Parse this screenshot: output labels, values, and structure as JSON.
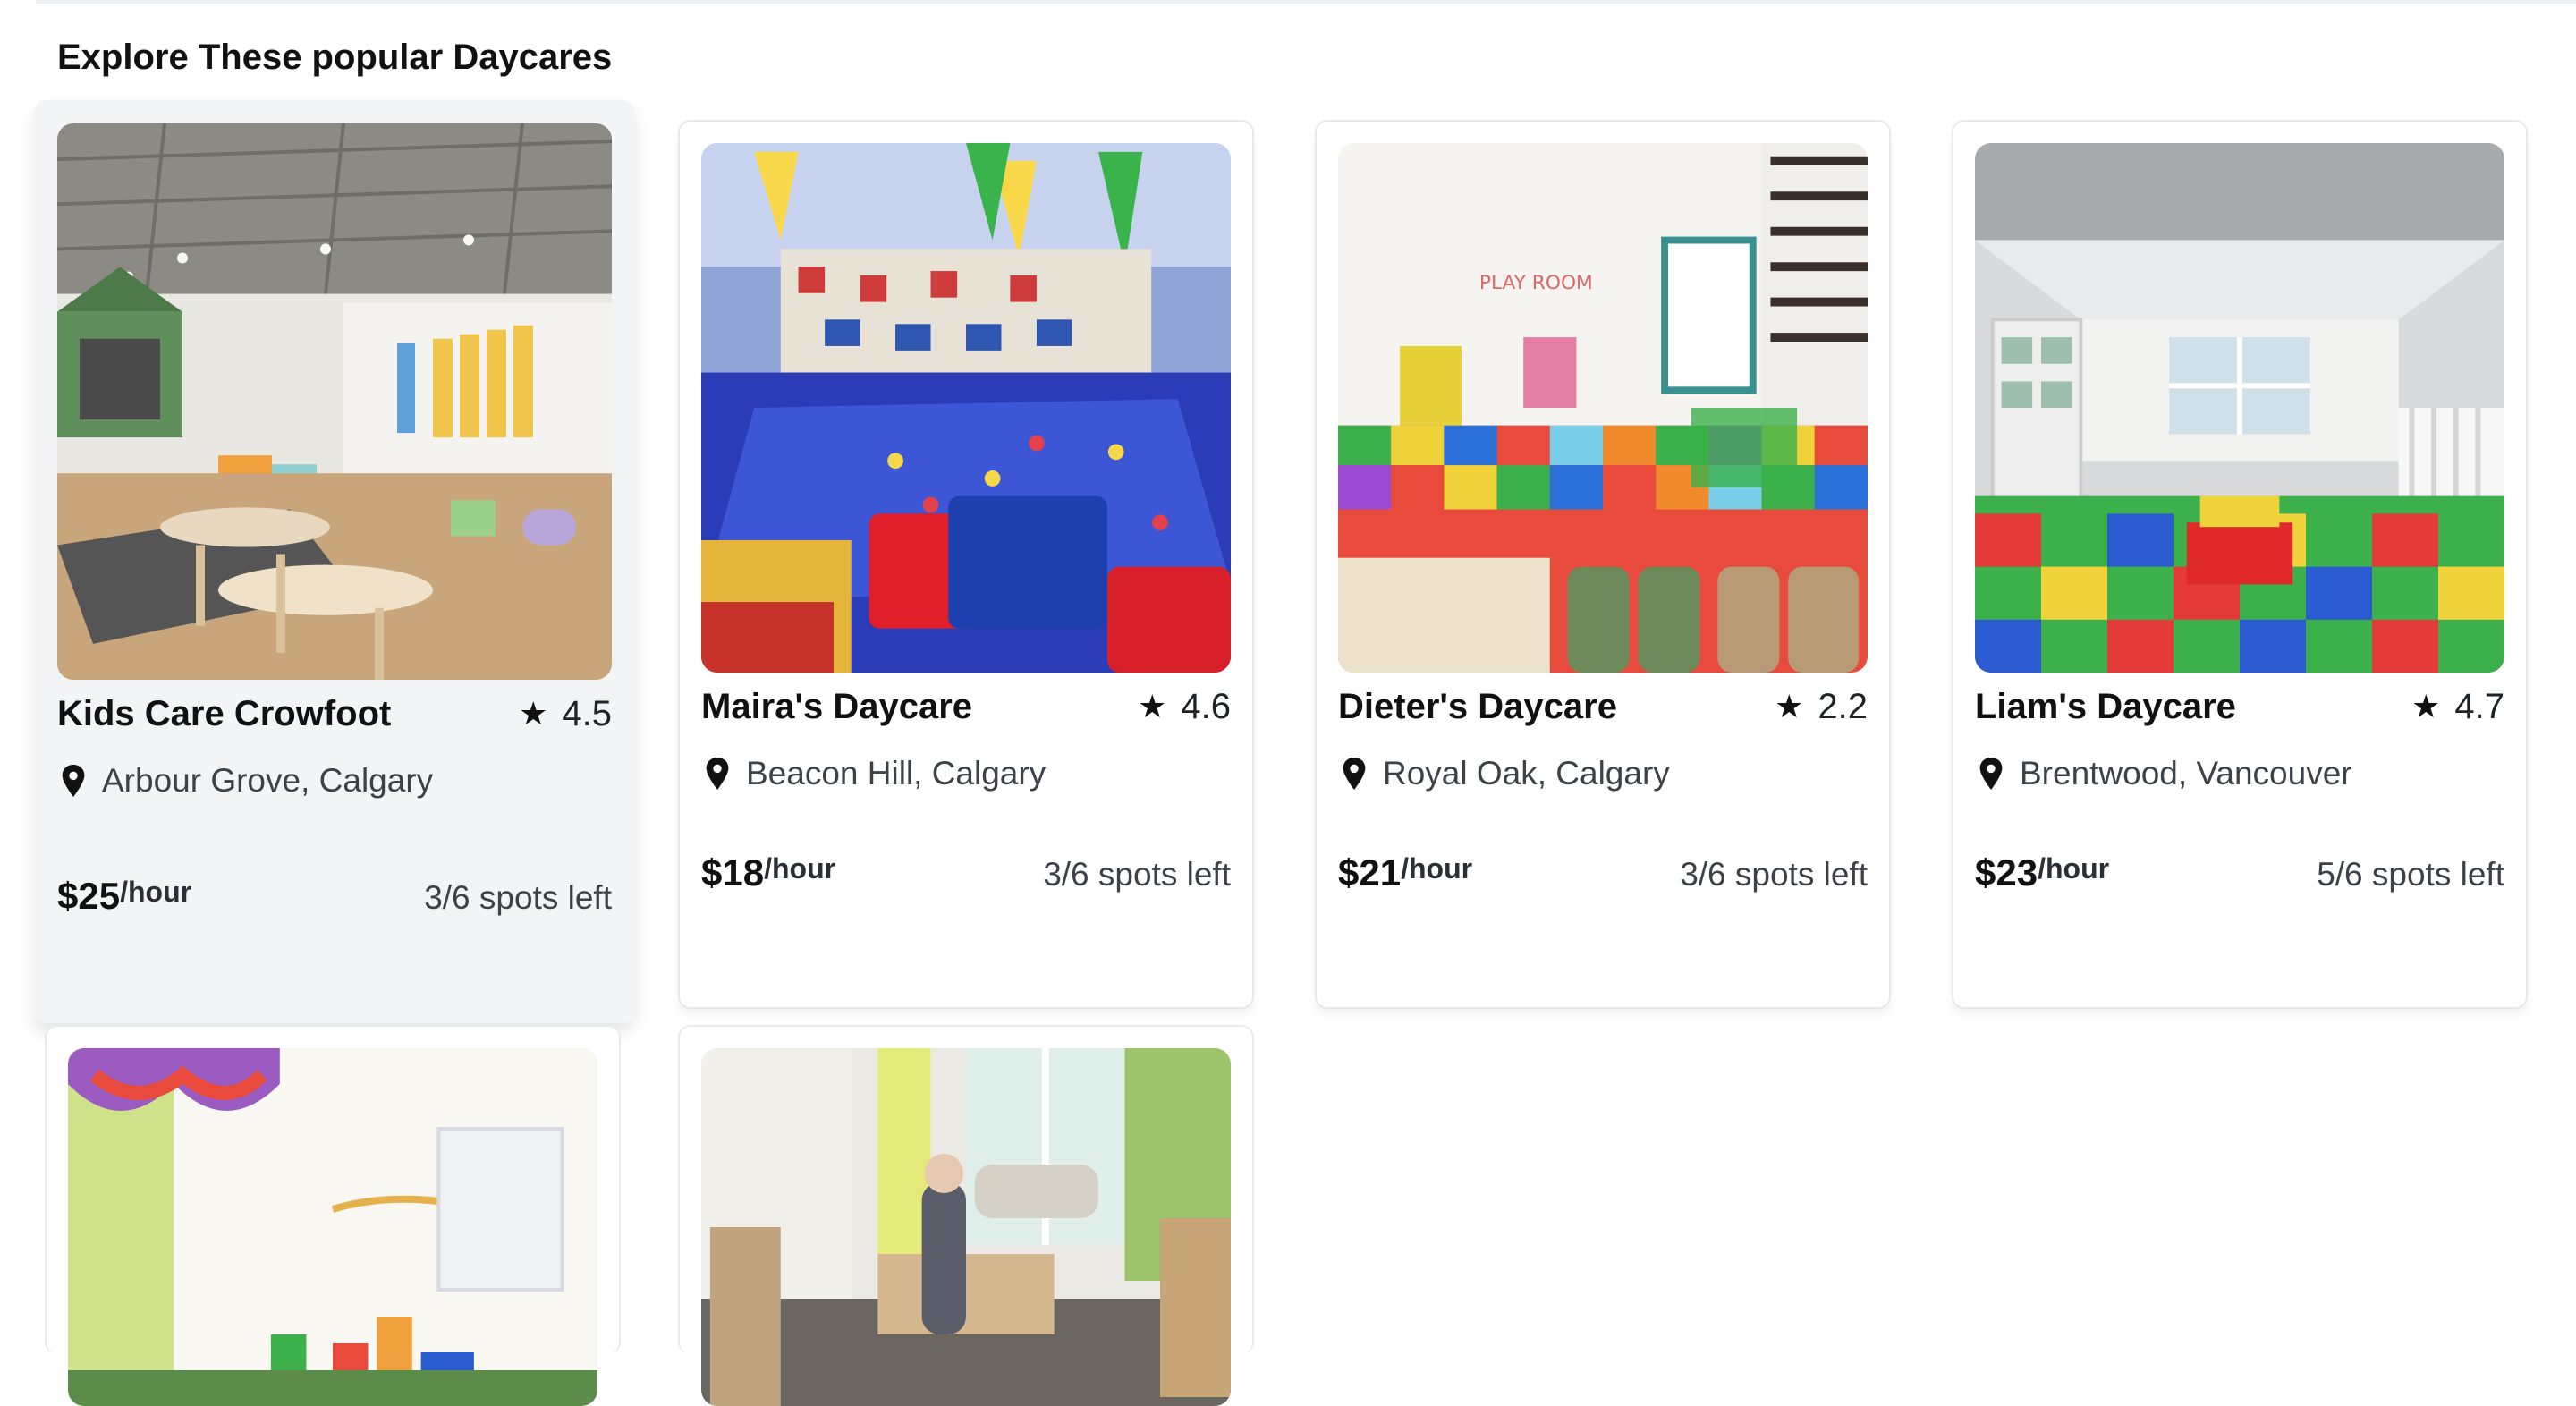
{
  "section_title": "Explore These popular Daycares",
  "cards": [
    {
      "name": "Kids Care Crowfoot",
      "rating": "4.5",
      "location": "Arbour Grove, Calgary",
      "price": "$25",
      "per": "/hour",
      "spots": "3/6 spots left"
    },
    {
      "name": "Maira's Daycare",
      "rating": "4.6",
      "location": "Beacon Hill, Calgary",
      "price": "$18",
      "per": "/hour",
      "spots": "3/6 spots left"
    },
    {
      "name": "Dieter's Daycare",
      "rating": "2.2",
      "location": "Royal Oak, Calgary",
      "price": "$21",
      "per": "/hour",
      "spots": "3/6 spots left"
    },
    {
      "name": "Liam's Daycare",
      "rating": "4.7",
      "location": "Brentwood, Vancouver",
      "price": "$23",
      "per": "/hour",
      "spots": "5/6 spots left"
    }
  ],
  "icons": {
    "star": "star-icon",
    "location": "location-pin-icon"
  },
  "colors": {
    "card_hover_bg": "#f3f4f6",
    "card_border": "#e7e9ec",
    "text": "#111111",
    "muted": "#3d4148"
  }
}
